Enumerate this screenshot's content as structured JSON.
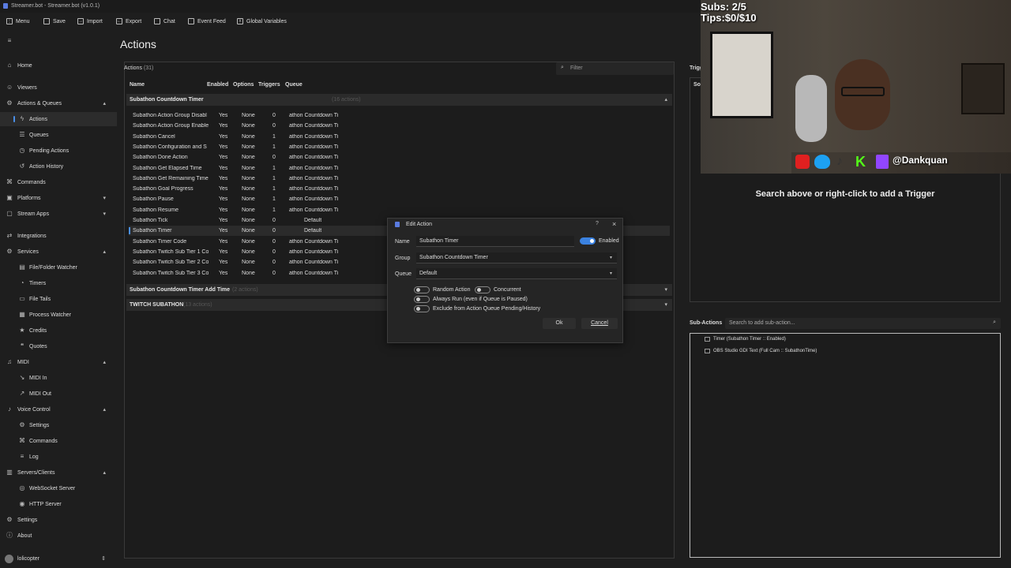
{
  "window": {
    "title": "Streamer.bot - Streamer.bot (v1.0.1)"
  },
  "toolbar": [
    "Menu",
    "Save",
    "Import",
    "Export",
    "Chat",
    "Event Feed",
    "Global Variables"
  ],
  "sidebar": {
    "items": [
      {
        "label": "Home",
        "icon": "home-icon"
      },
      {
        "label": "Viewers",
        "icon": "viewers-icon"
      },
      {
        "label": "Actions & Queues",
        "icon": "actions-icon",
        "chevron": "up"
      },
      {
        "label": "Actions",
        "icon": "bolt-icon",
        "sub": true,
        "active": true
      },
      {
        "label": "Queues",
        "icon": "queue-icon",
        "sub": true
      },
      {
        "label": "Pending Actions",
        "icon": "pending-icon",
        "sub": true
      },
      {
        "label": "Action History",
        "icon": "history-icon",
        "sub": true
      },
      {
        "label": "Commands",
        "icon": "commands-icon"
      },
      {
        "label": "Platforms",
        "icon": "platforms-icon",
        "chevron": "down"
      },
      {
        "label": "Stream Apps",
        "icon": "apps-icon",
        "chevron": "down"
      },
      {
        "label": "Integrations",
        "icon": "integrations-icon"
      },
      {
        "label": "Services",
        "icon": "services-icon",
        "chevron": "up"
      },
      {
        "label": "File/Folder Watcher",
        "icon": "folder-icon",
        "sub": true
      },
      {
        "label": "Timers",
        "icon": "timer-icon",
        "sub": true
      },
      {
        "label": "File Tails",
        "icon": "file-icon",
        "sub": true
      },
      {
        "label": "Process Watcher",
        "icon": "process-icon",
        "sub": true
      },
      {
        "label": "Credits",
        "icon": "credits-icon",
        "sub": true
      },
      {
        "label": "Quotes",
        "icon": "quote-icon",
        "sub": true
      },
      {
        "label": "MIDI",
        "icon": "midi-icon",
        "chevron": "up"
      },
      {
        "label": "MIDI In",
        "icon": "midi-in-icon",
        "sub": true
      },
      {
        "label": "MIDI Out",
        "icon": "midi-out-icon",
        "sub": true
      },
      {
        "label": "Voice Control",
        "icon": "voice-icon",
        "chevron": "up"
      },
      {
        "label": "Settings",
        "icon": "gear-icon",
        "sub": true
      },
      {
        "label": "Commands",
        "icon": "commands-icon",
        "sub": true
      },
      {
        "label": "Log",
        "icon": "log-icon",
        "sub": true
      },
      {
        "label": "Servers/Clients",
        "icon": "servers-icon",
        "chevron": "up"
      },
      {
        "label": "WebSocket Server",
        "icon": "websocket-icon",
        "sub": true
      },
      {
        "label": "HTTP Server",
        "icon": "http-icon",
        "sub": true
      },
      {
        "label": "Settings",
        "icon": "gear-icon"
      },
      {
        "label": "About",
        "icon": "info-icon"
      }
    ],
    "user": "lolicopter"
  },
  "main": {
    "title": "Actions",
    "actions_label": "Actions",
    "actions_count": "(31)",
    "filter_placeholder": "Filter",
    "columns": [
      "Name",
      "Enabled",
      "Options",
      "Triggers",
      "Queue"
    ],
    "groups": [
      {
        "name": "Subathon Countdown Timer",
        "count": "(16 actions)",
        "expanded": true
      },
      {
        "name": "Subathon Countdown Timer Add Time",
        "count": "(2 actions)",
        "expanded": false
      },
      {
        "name": "TWITCH SUBATHON",
        "count": "(13 actions)",
        "expanded": false
      }
    ],
    "rows": [
      [
        "Subathon Action Group Disabl",
        "Yes",
        "None",
        "0",
        "athon Countdown Ti"
      ],
      [
        "Subathon Action Group Enable",
        "Yes",
        "None",
        "0",
        "athon Countdown Ti"
      ],
      [
        "Subathon Cancel",
        "Yes",
        "None",
        "1",
        "athon Countdown Ti"
      ],
      [
        "Subathon Configuration and S",
        "Yes",
        "None",
        "1",
        "athon Countdown Ti"
      ],
      [
        "Subathon Done Action",
        "Yes",
        "None",
        "0",
        "athon Countdown Ti"
      ],
      [
        "Subathon Get Elapsed Time",
        "Yes",
        "None",
        "1",
        "athon Countdown Ti"
      ],
      [
        "Subathon Get Remaining Time",
        "Yes",
        "None",
        "1",
        "athon Countdown Ti"
      ],
      [
        "Subathon Goal Progress",
        "Yes",
        "None",
        "1",
        "athon Countdown Ti"
      ],
      [
        "Subathon Pause",
        "Yes",
        "None",
        "1",
        "athon Countdown Ti"
      ],
      [
        "Subathon Resume",
        "Yes",
        "None",
        "1",
        "athon Countdown Ti"
      ],
      [
        "Subathon Tick",
        "Yes",
        "None",
        "0",
        "Default"
      ],
      [
        "Subathon Timer",
        "Yes",
        "None",
        "0",
        "Default"
      ],
      [
        "Subathon Timer Code",
        "Yes",
        "None",
        "0",
        "athon Countdown Ti"
      ],
      [
        "Subathon Twitch Sub Tier 1 Co",
        "Yes",
        "None",
        "0",
        "athon Countdown Ti"
      ],
      [
        "Subathon Twitch Sub Tier 2 Co",
        "Yes",
        "None",
        "0",
        "athon Countdown Ti"
      ],
      [
        "Subathon Twitch Sub Tier 3 Co",
        "Yes",
        "None",
        "0",
        "athon Countdown Ti"
      ]
    ],
    "selected_row": 11
  },
  "triggers": {
    "tab": "Trigg",
    "col": "So",
    "empty_message": "Search above or right-click to add a Trigger"
  },
  "sub_actions": {
    "label": "Sub-Actions",
    "search_placeholder": "Search to add sub-action...",
    "items": [
      "Timer (Subathon Timer :: Enabled)",
      "OBS Studio GDI Text (Full Cam :: SubathonTime)"
    ]
  },
  "overlay": {
    "subs": "Subs: 2/5",
    "tips": "Tips:$0/$10",
    "handle": "@Dankquan"
  },
  "dialog": {
    "title": "Edit Action",
    "name_label": "Name",
    "name_value": "Subathon Timer",
    "enabled_label": "Enabled",
    "group_label": "Group",
    "group_value": "Subathon Countdown Timer",
    "queue_label": "Queue",
    "queue_value": "Default",
    "random_action": "Random Action",
    "concurrent": "Concurrent",
    "always_run": "Always Run (even if Queue is Paused)",
    "exclude": "Exclude from Action Queue Pending/History",
    "ok": "Ok",
    "cancel": "Cancel"
  },
  "colors": {
    "accent": "#3b82e0",
    "background": "#1e1e1e"
  }
}
